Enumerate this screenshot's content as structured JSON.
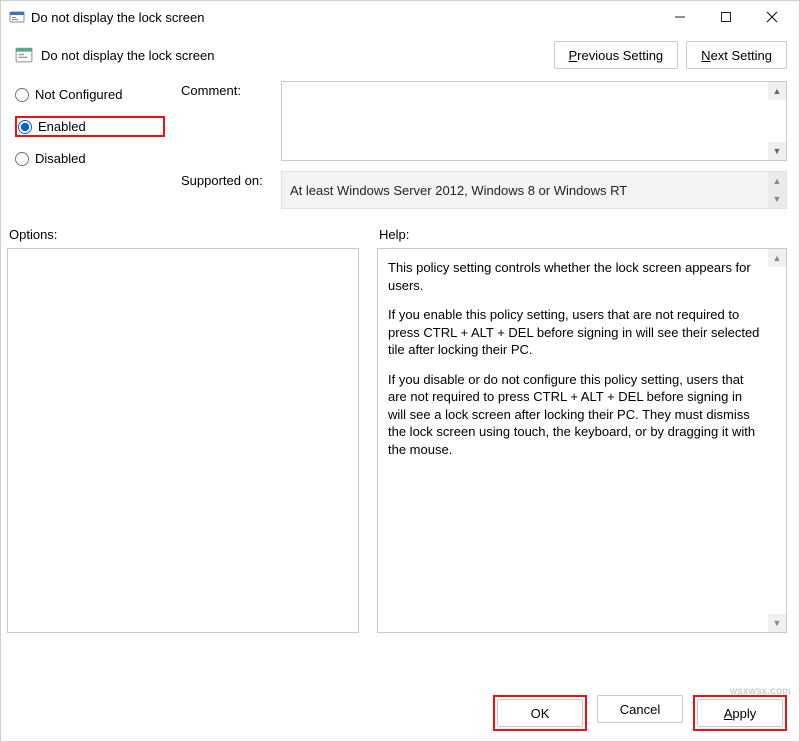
{
  "window": {
    "title": "Do not display the lock screen"
  },
  "header": {
    "policy_title": "Do not display the lock screen",
    "previous_btn_pre": "",
    "previous_btn_u": "P",
    "previous_btn_post": "revious Setting",
    "next_btn_pre": "",
    "next_btn_u": "N",
    "next_btn_post": "ext Setting"
  },
  "radios": {
    "not_configured_pre": "Not ",
    "not_configured_u": "C",
    "not_configured_post": "onfigured",
    "enabled_u": "E",
    "enabled_post": "nabled",
    "disabled_u": "D",
    "disabled_post": "isabled"
  },
  "fields": {
    "comment_label_u": "C",
    "comment_label_post": "omment:",
    "supported_label": "Supported on:",
    "supported_value": "At least Windows Server 2012, Windows 8 or Windows RT"
  },
  "sections": {
    "options_label": "Options:",
    "help_label": "Help:"
  },
  "help": {
    "p1": "This policy setting controls whether the lock screen appears for users.",
    "p2": "If you enable this policy setting, users that are not required to press CTRL + ALT + DEL before signing in will see their selected tile after locking their PC.",
    "p3": "If you disable or do not configure this policy setting, users that are not required to press CTRL + ALT + DEL before signing in will see a lock screen after locking their PC. They must dismiss the lock screen using touch, the keyboard, or by dragging it with the mouse."
  },
  "footer": {
    "ok": "OK",
    "cancel": "Cancel",
    "apply_u": "A",
    "apply_post": "pply"
  },
  "watermark": "wsxwsx.com"
}
